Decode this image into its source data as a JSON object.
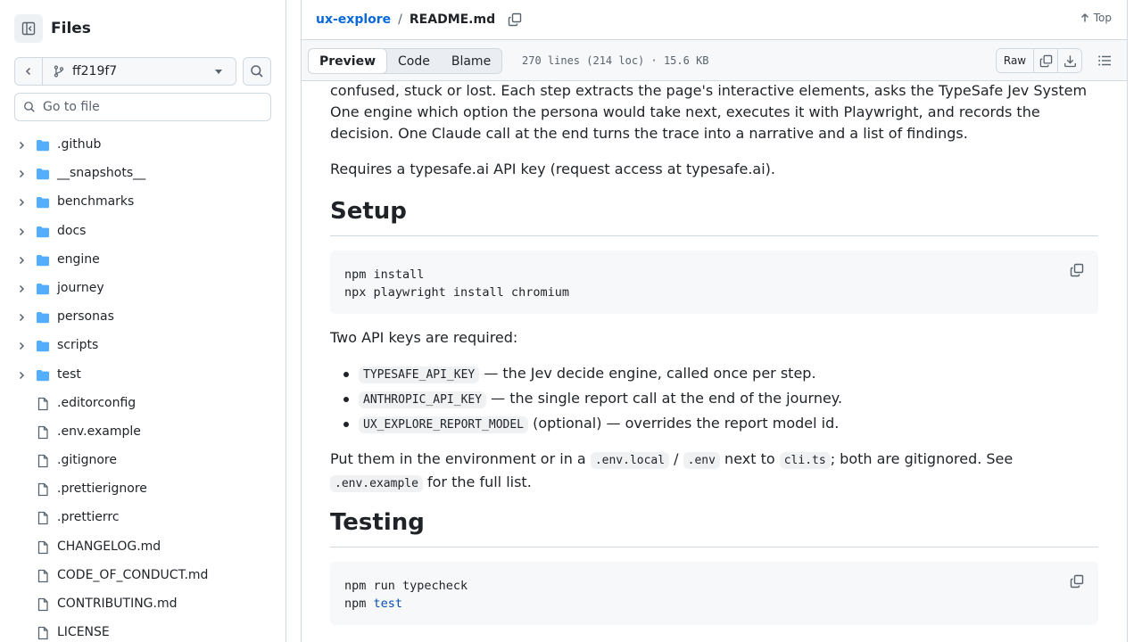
{
  "sidebar": {
    "title": "Files",
    "branch": "ff219f7",
    "goto_placeholder": "Go to file",
    "folders": [
      ".github",
      "__snapshots__",
      "benchmarks",
      "docs",
      "engine",
      "journey",
      "personas",
      "scripts",
      "test"
    ],
    "files": [
      ".editorconfig",
      ".env.example",
      ".gitignore",
      ".prettierignore",
      ".prettierrc",
      "CHANGELOG.md",
      "CODE_OF_CONDUCT.md",
      "CONTRIBUTING.md",
      "LICENSE"
    ]
  },
  "header": {
    "repo": "ux-explore",
    "separator": "/",
    "file": "README.md",
    "top_label": "Top"
  },
  "file_header": {
    "tabs": [
      "Preview",
      "Code",
      "Blame"
    ],
    "active_tab": "Preview",
    "meta": "270 lines (214 loc) · 15.6 KB",
    "raw_label": "Raw"
  },
  "readme": {
    "p1": "confused, stuck or lost. Each step extracts the page's interactive elements, asks the TypeSafe Jev System One engine which option the persona would take next, executes it with Playwright, and records the decision. One Claude call at the end turns the trace into a narrative and a list of findings.",
    "p2": "Requires a typesafe.ai API key (request access at typesafe.ai).",
    "setup_heading": "Setup",
    "setup_code_line1": "npm install",
    "setup_code_line2": "npx playwright install chromium",
    "p3": "Two API keys are required:",
    "keys": [
      {
        "code": "TYPESAFE_API_KEY",
        "text": " — the Jev decide engine, called once per step."
      },
      {
        "code": "ANTHROPIC_API_KEY",
        "text": " — the single report call at the end of the journey."
      },
      {
        "code": "UX_EXPLORE_REPORT_MODEL",
        "text": " (optional) — overrides the report model id."
      }
    ],
    "p4_a": "Put them in the environment or in a ",
    "p4_code1": ".env.local",
    "p4_b": " / ",
    "p4_code2": ".env",
    "p4_c": " next to ",
    "p4_code3": "cli.ts",
    "p4_d": "; both are gitignored. See ",
    "p4_code4": ".env.example",
    "p4_e": " for the full list.",
    "testing_heading": "Testing",
    "test_code_line1": "npm run typecheck",
    "test_code_line2_cmd": "npm ",
    "test_code_line2_kw": "test"
  }
}
